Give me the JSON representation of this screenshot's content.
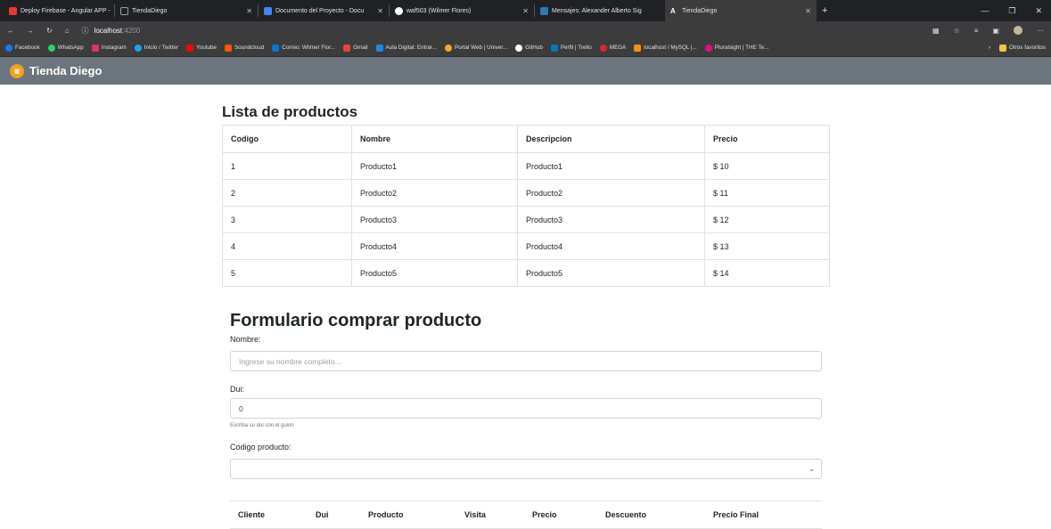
{
  "browser": {
    "tabs": [
      {
        "label": "Deploy Firebase - Angular APP -",
        "color": "#e53935",
        "active": false
      },
      {
        "label": "TiendaDiego",
        "color": "#9aa0a6",
        "active": false
      },
      {
        "label": "Documento del Proyecto - Docu",
        "color": "#4285f4",
        "active": false
      },
      {
        "label": "waf503 (Wilmer Flores)",
        "color": "#ffffff",
        "active": false
      },
      {
        "label": "Mensajes: Alexander Alberto Sig",
        "color": "#2b7bb9",
        "active": false
      },
      {
        "label": "TiendaDiego",
        "color": "#dd0031",
        "active": true
      }
    ],
    "url_host": "localhost",
    "url_port": ":4200",
    "bookmarks": [
      {
        "label": "Facebook",
        "color": "#1877f2"
      },
      {
        "label": "WhatsApp",
        "color": "#25d366"
      },
      {
        "label": "Instagram",
        "color": "#e1306c"
      },
      {
        "label": "Inicio / Twitter",
        "color": "#1da1f2"
      },
      {
        "label": "Youtube",
        "color": "#ff0000"
      },
      {
        "label": "Soundcloud",
        "color": "#ff5500"
      },
      {
        "label": "Correo: Wilmer Flor...",
        "color": "#0078d4"
      },
      {
        "label": "Gmail",
        "color": "#ea4335"
      },
      {
        "label": "Aula Digital: Entrar...",
        "color": "#1e88e5"
      },
      {
        "label": "Portal Web | Univer...",
        "color": "#f9a825"
      },
      {
        "label": "GitHub",
        "color": "#ffffff"
      },
      {
        "label": "Perfil | Trello",
        "color": "#0079bf"
      },
      {
        "label": "MEGA",
        "color": "#d9272e"
      },
      {
        "label": "localhost / MySQL |...",
        "color": "#f29111"
      },
      {
        "label": "Pluralsight | THE Te...",
        "color": "#e80a89"
      }
    ],
    "other_favorites": "Otros favoritos"
  },
  "navbar": {
    "brand": "Tienda Diego"
  },
  "products": {
    "title": "Lista de productos",
    "headers": [
      "Codigo",
      "Nombre",
      "Descripcion",
      "Precio"
    ],
    "rows": [
      [
        "1",
        "Producto1",
        "Producto1",
        "$ 10"
      ],
      [
        "2",
        "Producto2",
        "Producto2",
        "$ 11"
      ],
      [
        "3",
        "Producto3",
        "Producto3",
        "$ 12"
      ],
      [
        "4",
        "Producto4",
        "Producto4",
        "$ 13"
      ],
      [
        "5",
        "Producto5",
        "Producto5",
        "$ 14"
      ]
    ]
  },
  "form": {
    "title": "Formulario comprar producto",
    "name_label": "Nombre:",
    "name_placeholder": "Ingrese su nombre completo...",
    "dui_label": "Dui:",
    "dui_value": "0",
    "dui_help": "Escriba su dui con el guion",
    "code_label": "Codigo producto:"
  },
  "sales": {
    "headers": [
      "Cliente",
      "Dui",
      "Producto",
      "Visita",
      "Precio",
      "Descuento",
      "Precio Final"
    ]
  }
}
